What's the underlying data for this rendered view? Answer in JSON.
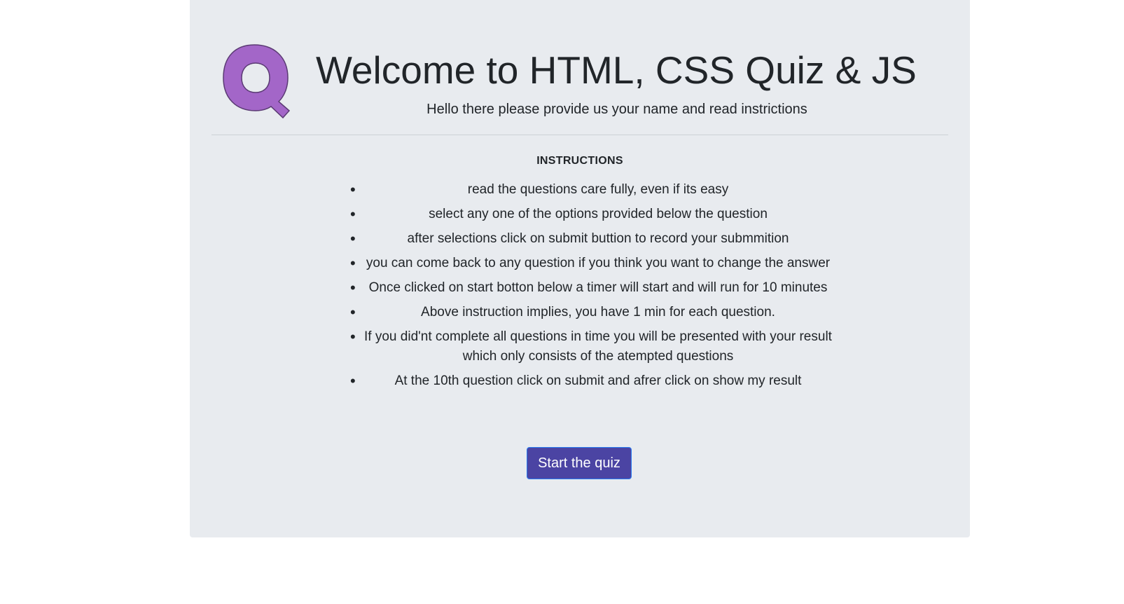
{
  "header": {
    "logo_icon": "quiz-q-logo",
    "logo_color": "#a366c8",
    "title": "Welcome to HTML, CSS Quiz & JS",
    "subtitle": "Hello there please provide us your name and read instrictions"
  },
  "instructions": {
    "heading": "INSTRUCTIONS",
    "items": [
      "read the questions care fully, even if its easy",
      "select any one of the options provided below the question",
      "after selections click on submit buttion to record your submmition",
      "you can come back to any question if you think you want to change the answer",
      "Once clicked on start botton below a timer will start and will run for 10 minutes",
      "Above instruction implies, you have 1 min for each question.",
      "If you did'nt complete all questions in time you will be presented with your result which only consists of the atempted questions",
      "At the 10th question click on submit and afrer click on show my result"
    ]
  },
  "actions": {
    "start_label": "Start the quiz",
    "start_color": "#4b44a3"
  },
  "colors": {
    "card_background": "#e8ebef",
    "page_background": "#ffffff"
  }
}
